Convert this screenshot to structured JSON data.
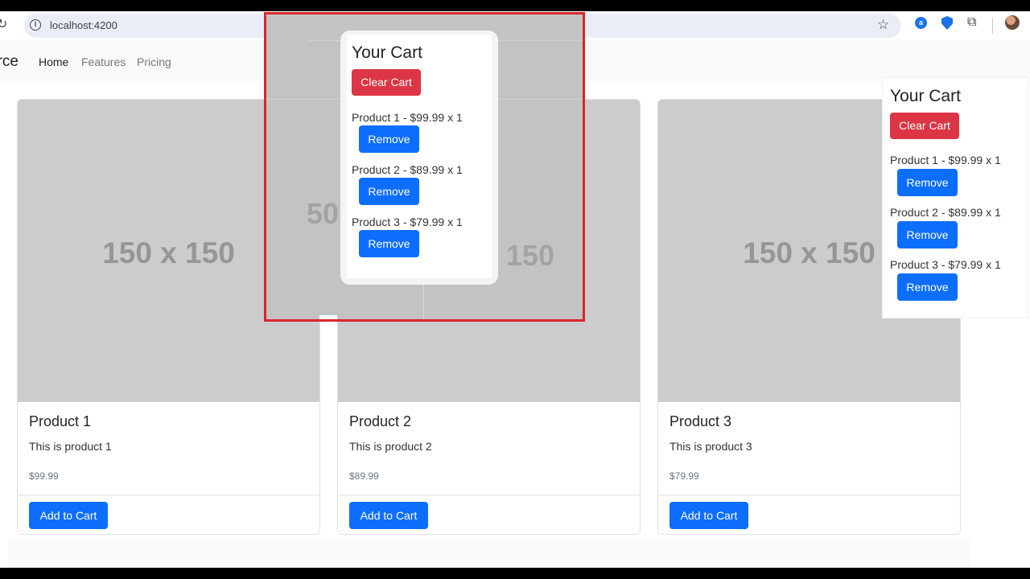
{
  "browser": {
    "url": "localhost:4200",
    "icons": [
      "reload-icon",
      "info-icon",
      "star-icon",
      "extension-icons",
      "profile-avatar"
    ]
  },
  "navbar": {
    "brand": "erce",
    "links": [
      "Home",
      "Features",
      "Pricing"
    ]
  },
  "products": [
    {
      "placeholder": "150 x 150",
      "title": "Product 1",
      "text": "This is product 1",
      "price": "$99.99",
      "button": "Add to Cart"
    },
    {
      "placeholder": "150 x 150",
      "title": "Product 2",
      "text": "This is product 2",
      "price": "$89.99",
      "button": "Add to Cart"
    },
    {
      "placeholder": "150 x 150",
      "title": "Product 3",
      "text": "This is product 3",
      "price": "$79.99",
      "button": "Add to Cart"
    }
  ],
  "cart": {
    "title": "Your Cart",
    "clear_label": "Clear Cart",
    "items": [
      {
        "text": "Product 1 - $99.99 x 1",
        "remove_label": "Remove"
      },
      {
        "text": "Product 2 - $89.99 x 1",
        "remove_label": "Remove"
      },
      {
        "text": "Product 3 - $79.99 x 1",
        "remove_label": "Remove"
      }
    ]
  },
  "overlay": {
    "ghost_left": "50",
    "ghost_right": "150"
  },
  "colors": {
    "primary": "#0d6efd",
    "danger": "#dc3545",
    "highlight_border": "#d9262c",
    "placeholder_bg": "#cccccc"
  }
}
